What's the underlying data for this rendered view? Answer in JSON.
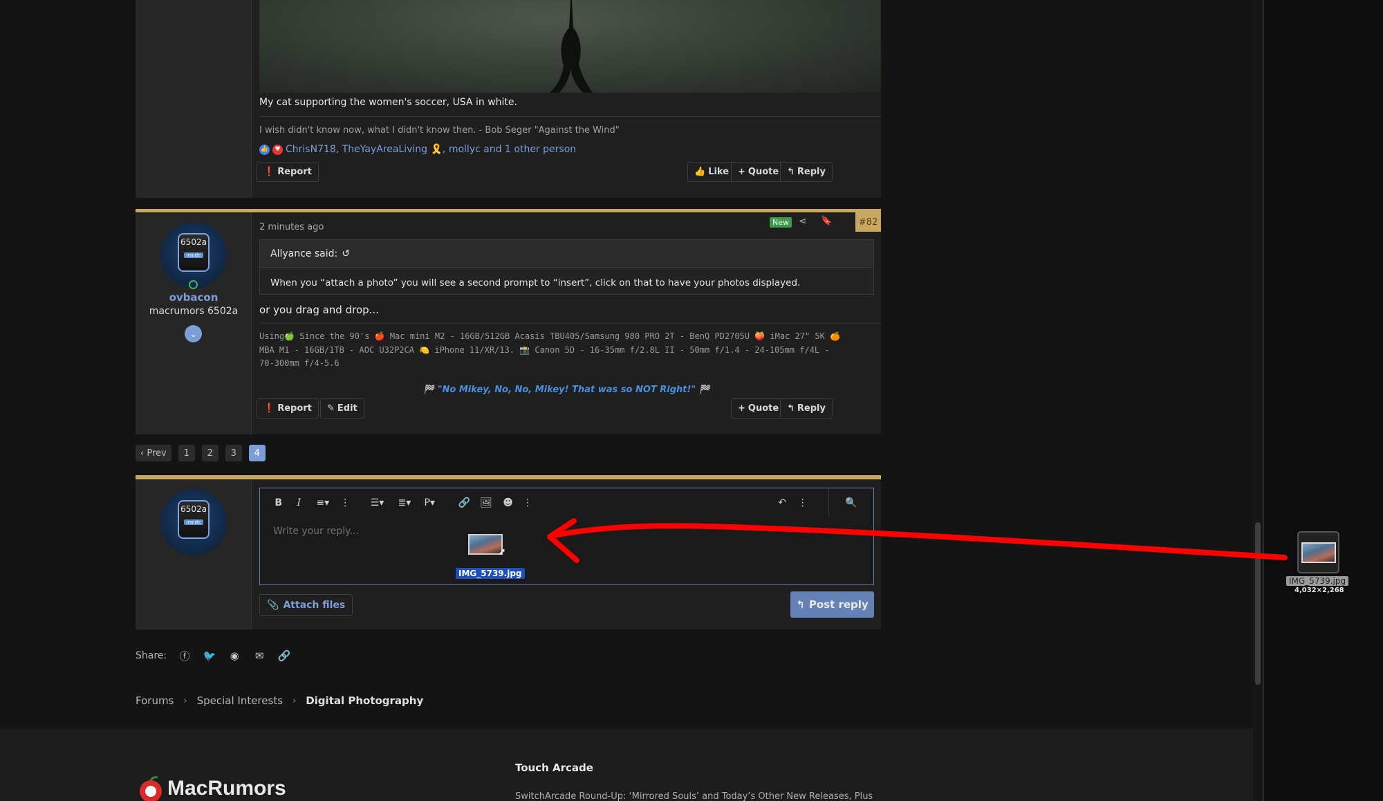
{
  "post1": {
    "caption": "My cat supporting the women's soccer, USA in white.",
    "signature": "I wish didn't know now, what I didn't know then. - Bob Seger \"Against the Wind\"",
    "reactions_text": "ChrisN718, TheYayAreaLiving 🎗️, mollyc and 1 other person",
    "buttons": {
      "report": "Report",
      "like": "Like",
      "quote": "Quote",
      "reply": "Reply"
    }
  },
  "post2": {
    "username": "ovbacon",
    "user_title": "macrumors 6502a",
    "avatar_chip": "6502a",
    "avatar_inside": "inside",
    "time": "2 minutes ago",
    "new_badge": "New",
    "post_number": "#82",
    "quote_author": "Allyance said:",
    "quote_text": "When you “attach a photo” you will see a second prompt to “insert”, click on that to have your photos displayed.",
    "text": "or you drag and drop...",
    "signature_lines": [
      "Using🍏 Since the 90's 🍎 Mac mini M2 - 16GB/512GB Acasis TBU405/Samsung 980 PRO 2T - BenQ PD2705U 🍑 iMac 27\" 5K 🍊",
      "MBA M1 - 16GB/1TB - AOC U32P2CA 🍋 iPhone 11/XR/13. 📸 Canon 5D - 16-35mm f/2.8L II - 50mm f/1.4 - 24-105mm f/4L -",
      "70-300mm f/4-5.6"
    ],
    "motto": "\"No Mikey, No, No, Mikey! That was so NOT Right!\"",
    "buttons": {
      "report": "Report",
      "edit": "Edit",
      "quote": "Quote",
      "reply": "Reply"
    }
  },
  "pagination": {
    "prev": "‹ Prev",
    "pages": [
      "1",
      "2",
      "3",
      "4"
    ],
    "current": "4"
  },
  "reply": {
    "placeholder": "Write your reply...",
    "dragged_file": "IMG_5739.jpg",
    "attach_label": "Attach files",
    "post_label": "Post reply"
  },
  "share": {
    "label": "Share:"
  },
  "breadcrumb": [
    "Forums",
    "Special Interests",
    "Digital Photography"
  ],
  "footer": {
    "logo": "MacRumors",
    "heading": "Touch Arcade",
    "article": "SwitchArcade Round-Up: ‘Mirrored Souls’ and Today’s Other New Releases, Plus"
  },
  "desktop_file": {
    "name": "IMG_5739.jpg",
    "dimensions": "4,032×2,268"
  },
  "colors": {
    "accent": "#c9a961",
    "link": "#7b9ed9",
    "arrow": "#ff0000",
    "online": "#4caf50"
  }
}
